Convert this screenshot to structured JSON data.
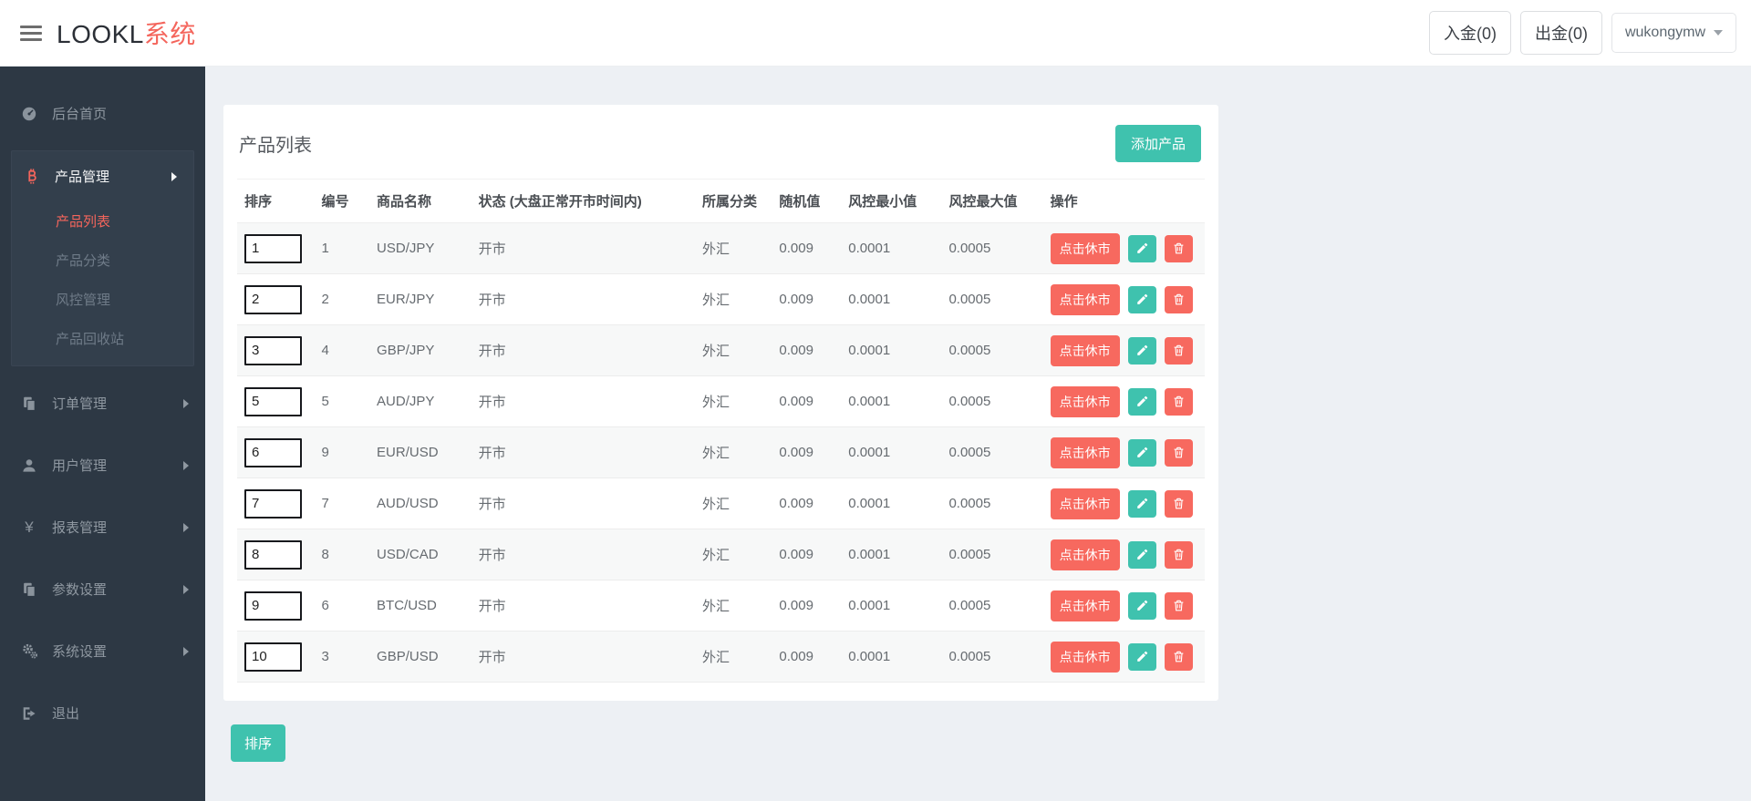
{
  "header": {
    "logo_primary": "LOOKL",
    "logo_accent": "系统",
    "deposit_label": "入金(0)",
    "withdraw_label": "出金(0)",
    "username": "wukongymw"
  },
  "sidebar": {
    "items": [
      {
        "label": "后台首页",
        "icon": "dashboard-icon"
      },
      {
        "label": "产品管理",
        "icon": "bitcoin-icon",
        "expanded": true,
        "submenu": [
          {
            "label": "产品列表",
            "active": true
          },
          {
            "label": "产品分类",
            "active": false
          },
          {
            "label": "风控管理",
            "active": false
          },
          {
            "label": "产品回收站",
            "active": false
          }
        ]
      },
      {
        "label": "订单管理",
        "icon": "files-icon"
      },
      {
        "label": "用户管理",
        "icon": "user-icon"
      },
      {
        "label": "报表管理",
        "icon": "yen-icon",
        "icon_glyph": "¥"
      },
      {
        "label": "参数设置",
        "icon": "files-icon"
      },
      {
        "label": "系统设置",
        "icon": "gears-icon"
      },
      {
        "label": "退出",
        "icon": "signout-icon"
      }
    ]
  },
  "main": {
    "title": "产品列表",
    "add_button": "添加产品",
    "sort_button": "排序",
    "table": {
      "headers": [
        "排序",
        "编号",
        "商品名称",
        "状态 (大盘正常开市时间内)",
        "所属分类",
        "随机值",
        "风控最小值",
        "风控最大值",
        "操作"
      ],
      "actions": {
        "close_market": "点击休市",
        "edit": "edit-icon",
        "delete": "trash-icon"
      },
      "rows": [
        {
          "sort": "1",
          "id": "1",
          "name": "USD/JPY",
          "status": "开市",
          "category": "外汇",
          "random": "0.009",
          "risk_min": "0.0001",
          "risk_max": "0.0005"
        },
        {
          "sort": "2",
          "id": "2",
          "name": "EUR/JPY",
          "status": "开市",
          "category": "外汇",
          "random": "0.009",
          "risk_min": "0.0001",
          "risk_max": "0.0005"
        },
        {
          "sort": "3",
          "id": "4",
          "name": "GBP/JPY",
          "status": "开市",
          "category": "外汇",
          "random": "0.009",
          "risk_min": "0.0001",
          "risk_max": "0.0005"
        },
        {
          "sort": "5",
          "id": "5",
          "name": "AUD/JPY",
          "status": "开市",
          "category": "外汇",
          "random": "0.009",
          "risk_min": "0.0001",
          "risk_max": "0.0005"
        },
        {
          "sort": "6",
          "id": "9",
          "name": "EUR/USD",
          "status": "开市",
          "category": "外汇",
          "random": "0.009",
          "risk_min": "0.0001",
          "risk_max": "0.0005"
        },
        {
          "sort": "7",
          "id": "7",
          "name": "AUD/USD",
          "status": "开市",
          "category": "外汇",
          "random": "0.009",
          "risk_min": "0.0001",
          "risk_max": "0.0005"
        },
        {
          "sort": "8",
          "id": "8",
          "name": "USD/CAD",
          "status": "开市",
          "category": "外汇",
          "random": "0.009",
          "risk_min": "0.0001",
          "risk_max": "0.0005"
        },
        {
          "sort": "9",
          "id": "6",
          "name": "BTC/USD",
          "status": "开市",
          "category": "外汇",
          "random": "0.009",
          "risk_min": "0.0001",
          "risk_max": "0.0005"
        },
        {
          "sort": "10",
          "id": "3",
          "name": "GBP/USD",
          "status": "开市",
          "category": "外汇",
          "random": "0.009",
          "risk_min": "0.0001",
          "risk_max": "0.0005"
        }
      ]
    }
  },
  "colors": {
    "accent_teal": "#3fc2ae",
    "accent_coral": "#f4655c",
    "sidebar_bg": "#2d3844"
  }
}
